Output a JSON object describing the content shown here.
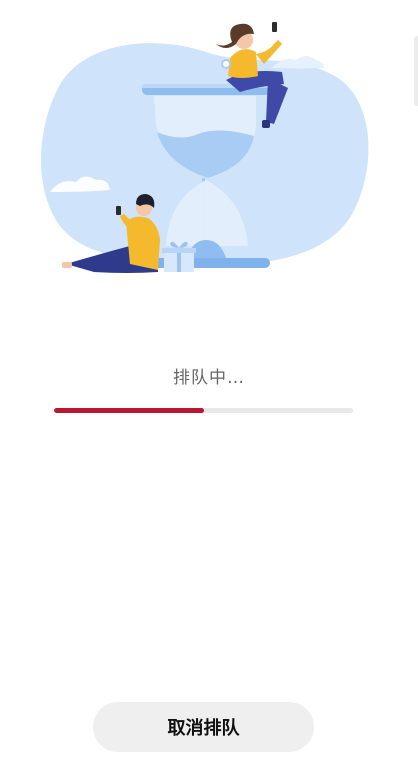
{
  "queue": {
    "status_text": "排队中…",
    "progress": 0.5,
    "progress_color": "#b8172f",
    "track_color": "#e8e8e8"
  },
  "actions": {
    "cancel_label": "取消排队"
  },
  "illustration": {
    "icon": "hourglass-waiting-illustration"
  }
}
